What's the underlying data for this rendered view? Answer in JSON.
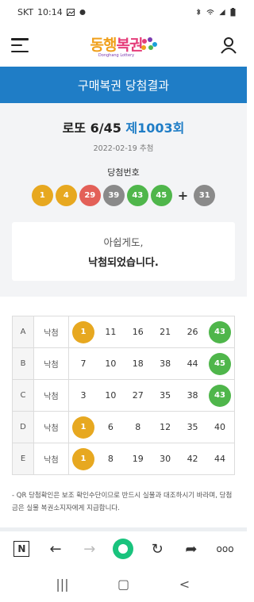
{
  "status": {
    "carrier": "SKT",
    "time": "10:14"
  },
  "header": {
    "logo_text_1": "동행",
    "logo_text_2": "복권",
    "logo_sub": "Donghang Lottery"
  },
  "title": "구매복권 당첨결과",
  "draw": {
    "game": "로또 6/45 ",
    "round": "제1003회",
    "date": "2022-02-19 추첨"
  },
  "winning_label": "당첨번호",
  "winning_numbers": [
    {
      "n": "1",
      "color": "#e7a820"
    },
    {
      "n": "4",
      "color": "#e7a820"
    },
    {
      "n": "29",
      "color": "#e36058"
    },
    {
      "n": "39",
      "color": "#8a8a8a"
    },
    {
      "n": "43",
      "color": "#4fb64b"
    },
    {
      "n": "45",
      "color": "#4fb64b"
    }
  ],
  "plus": "+",
  "bonus": {
    "n": "31",
    "color": "#8a8a8a"
  },
  "result": {
    "line1": "아쉽게도,",
    "line2": "낙첨되었습니다."
  },
  "games": [
    {
      "label": "A",
      "status": "낙첨",
      "numbers": [
        "1",
        "11",
        "16",
        "21",
        "26",
        "43"
      ]
    },
    {
      "label": "B",
      "status": "낙첨",
      "numbers": [
        "7",
        "10",
        "18",
        "38",
        "44",
        "45"
      ]
    },
    {
      "label": "C",
      "status": "낙첨",
      "numbers": [
        "3",
        "10",
        "27",
        "35",
        "38",
        "43"
      ]
    },
    {
      "label": "D",
      "status": "낙첨",
      "numbers": [
        "1",
        "6",
        "8",
        "12",
        "35",
        "40"
      ]
    },
    {
      "label": "E",
      "status": "낙첨",
      "numbers": [
        "1",
        "8",
        "19",
        "30",
        "42",
        "44"
      ]
    }
  ],
  "hit_colors": {
    "1": "#e7a820",
    "4": "#e7a820",
    "43": "#4fb64b",
    "45": "#4fb64b",
    "29": "#e36058",
    "39": "#8a8a8a"
  },
  "notice": "- QR 당첨확인은 보조 확인수단이므로 반드시 실물과 대조하시기 바라며, 당첨금은 실물 복권소지자에게 지급합니다.",
  "browser": {
    "n_label": "N",
    "back": "←",
    "forward": "→",
    "reload": "↻",
    "share": "➦",
    "more": "ooo"
  },
  "nav": {
    "recents": "|||",
    "home": "▢",
    "back": "<"
  }
}
